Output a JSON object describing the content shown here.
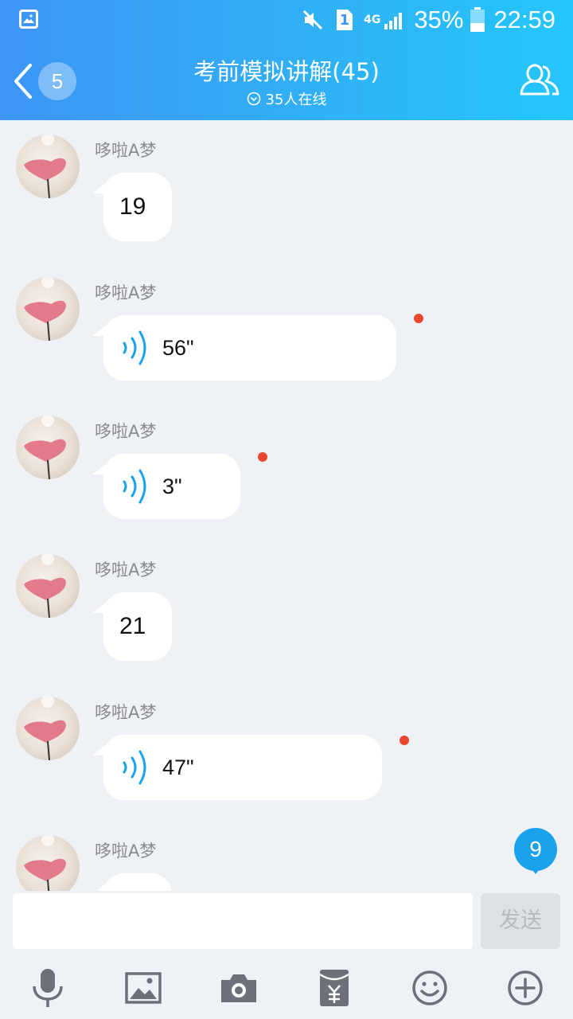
{
  "status_bar": {
    "sim_slot": "1",
    "network": "4G",
    "battery_percent": "35%",
    "time": "22:59"
  },
  "header": {
    "back_unread_count": "5",
    "title": "考前模拟讲解(45)",
    "online_text": "35人在线"
  },
  "messages": [
    {
      "sender": "哆啦A梦",
      "type": "text",
      "text": "19"
    },
    {
      "sender": "哆啦A梦",
      "type": "voice",
      "duration": "56\"",
      "unplayed": true
    },
    {
      "sender": "哆啦A梦",
      "type": "voice",
      "duration": "3\"",
      "unplayed": true
    },
    {
      "sender": "哆啦A梦",
      "type": "text",
      "text": "21"
    },
    {
      "sender": "哆啦A梦",
      "type": "voice",
      "duration": "47\"",
      "unplayed": true
    },
    {
      "sender": "哆啦A梦",
      "type": "text",
      "text": ""
    }
  ],
  "new_message_badge": "9",
  "input": {
    "value": "",
    "placeholder": "",
    "send_label": "发送"
  },
  "toolbar": {
    "items": [
      "microphone-icon",
      "image-icon",
      "camera-icon",
      "red-packet-icon",
      "emoji-icon",
      "plus-icon"
    ]
  },
  "colors": {
    "header_gradient_start": "#3d95f6",
    "header_gradient_end": "#24c6fb",
    "accent_blue": "#1aa3ec",
    "unplayed_dot": "#e9482f",
    "chat_background": "#eef1f6"
  }
}
